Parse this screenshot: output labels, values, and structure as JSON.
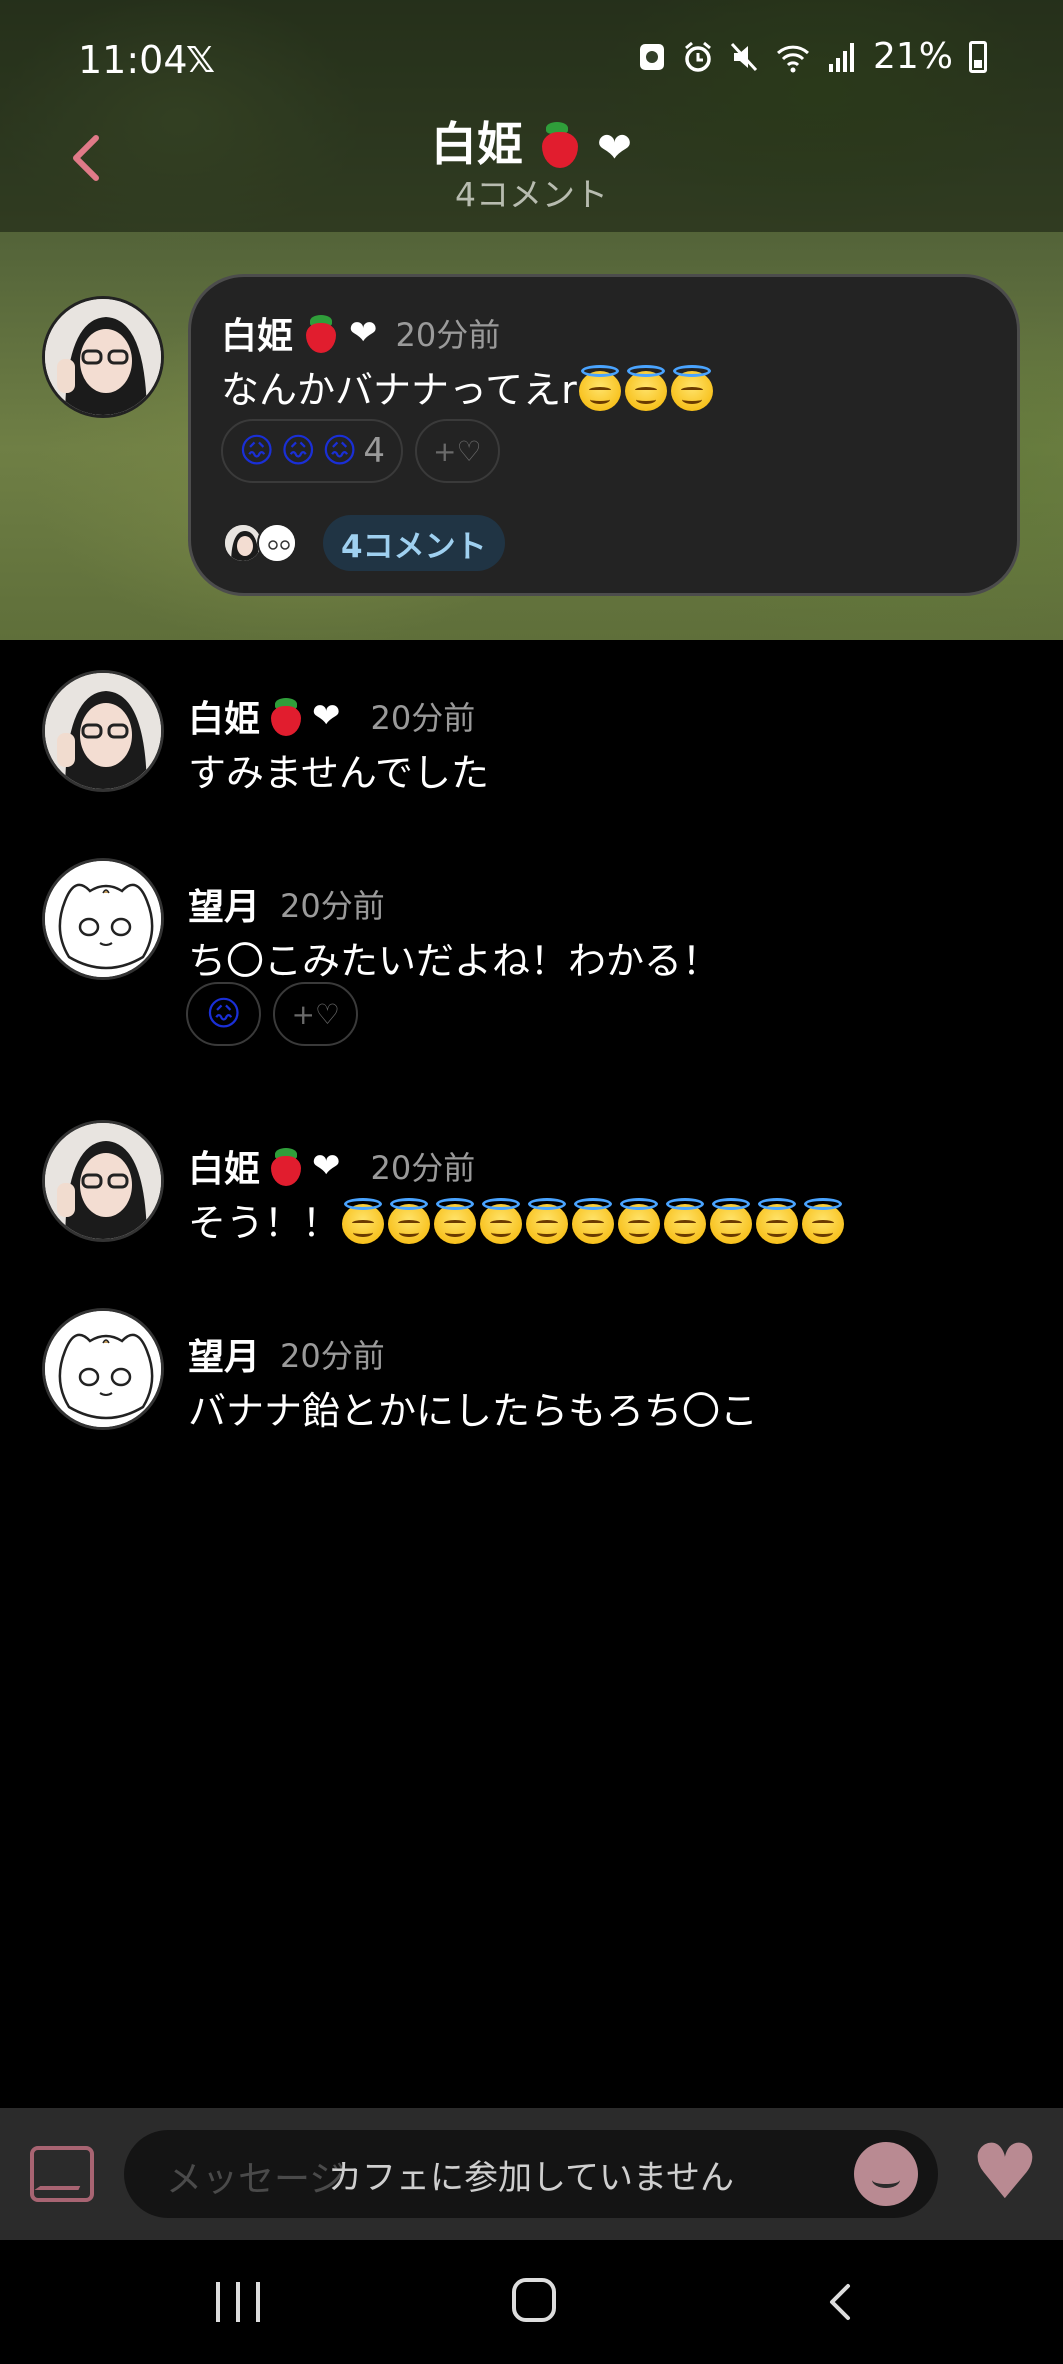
{
  "status_bar": {
    "time": "11:04",
    "x_glyph": "𝕏",
    "battery": "21%"
  },
  "header": {
    "title": "白姫",
    "subtitle": "4コメント"
  },
  "post": {
    "author": "白姫",
    "time": "20分前",
    "text": "なんかバナナってえr",
    "text_emoji_count": 3,
    "reaction_emoji": "😖",
    "reaction_count": "4",
    "add_reaction": "+♡",
    "comment_badge": "4コメント"
  },
  "comments": [
    {
      "author": "白姫",
      "time": "20分前",
      "text": "すみませんでした"
    },
    {
      "author": "望月",
      "time": "20分前",
      "text": "ち〇こみたいだよね！わかる！",
      "add_reaction": "+♡"
    },
    {
      "author": "白姫",
      "time": "20分前",
      "text": "そう！！"
    },
    {
      "author": "望月",
      "time": "20分前",
      "text": "バナナ飴とかにしたらもろち〇こ"
    }
  ],
  "input": {
    "placeholder": "メッセージ",
    "overlay": "カフェに参加していません"
  },
  "colors": {
    "accent_pink": "#b98a92",
    "badge_text": "#9fd0f0",
    "card_bg": "#232323"
  }
}
